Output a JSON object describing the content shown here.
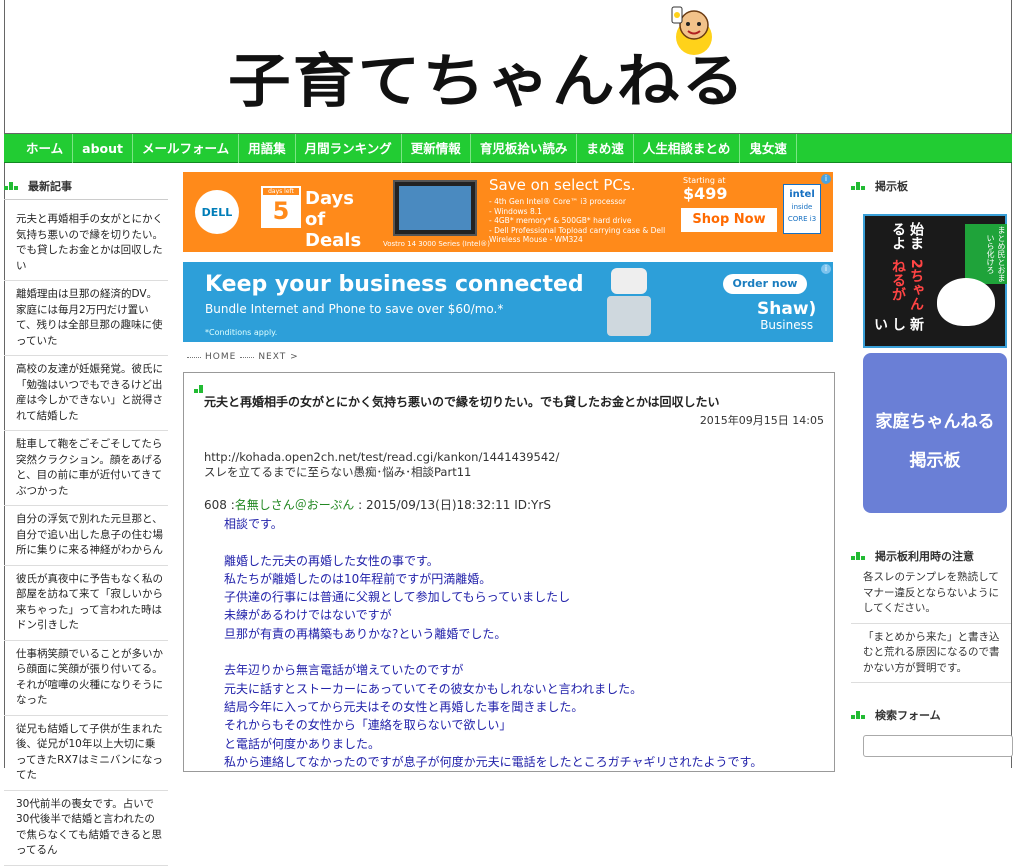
{
  "site": {
    "title": "子育てちゃんねる"
  },
  "nav": [
    {
      "label": "ホーム"
    },
    {
      "label": "about"
    },
    {
      "label": "メールフォーム"
    },
    {
      "label": "用語集"
    },
    {
      "label": "月間ランキング"
    },
    {
      "label": "更新情報"
    },
    {
      "label": "育児板拾い読み"
    },
    {
      "label": "まめ速"
    },
    {
      "label": "人生相談まとめ"
    },
    {
      "label": "鬼女速"
    }
  ],
  "sidebar_left": {
    "heading": "最新記事",
    "articles": [
      "元夫と再婚相手の女がとにかく気持ち悪いので縁を切りたい。でも貸したお金とかは回収したい",
      "離婚理由は旦那の経済的DV。家庭には毎月2万円だけ置いて、残りは全部旦那の趣味に使っていた",
      "高校の友達が妊娠発覚。彼氏に「勉強はいつでもできるけど出産は今しかできない」と説得されて結婚した",
      "駐車して鞄をごそごそしてたら突然クラクション。顔をあげると、目の前に車が近付いてきてぶつかった",
      "自分の浮気で別れた元旦那と、自分で追い出した息子の住む場所に集りに来る神経がわからん",
      "彼氏が真夜中に予告もなく私の部屋を訪ねて来て「寂しいから来ちゃった」って言われた時はドン引きした",
      "仕事柄笑顔でいることが多いから顔面に笑顔が張り付いてる。それが喧嘩の火種になりそうになった",
      "従兄も結婚して子供が生まれた後、従兄が10年以上大切に乗ってきたRX7はミニバンになってた",
      "30代前半の喪女です。占いで30代後半で結婚と言われたので焦らなくても結婚できると思ってるん"
    ]
  },
  "ads": {
    "ad1": {
      "brand": "DELL",
      "days_tag": "days left",
      "days_num": "5",
      "days_title": "Days of Deals",
      "headline": "Save on select PCs.",
      "starting": "Starting at",
      "price": "$499",
      "specs": [
        "- 4th Gen Intel® Core™ i3 processor",
        "- Windows 8.1",
        "- 4GB* memory* & 500GB* hard drive",
        "- Dell Professional Topload carrying case & Dell Wireless Mouse - WM324"
      ],
      "model": "Vostro 14 3000 Series (Intel®)",
      "cta": "Shop Now",
      "intel_line1": "intel",
      "intel_line2": "inside",
      "intel_line3": "CORE i3"
    },
    "ad2": {
      "headline": "Keep your business connected",
      "sub": "Bundle Internet and Phone to save over $60/mo.*",
      "note": "*Conditions apply.",
      "cta": "Order now",
      "brand": "Shaw)",
      "brand_sub": "Business"
    }
  },
  "breadcrumb": {
    "home": "HOME",
    "next": "NEXT >"
  },
  "post": {
    "title": "元夫と再婚相手の女がとにかく気持ち悪いので縁を切りたい。でも貸したお金とかは回収したい",
    "date": "2015年09月15日 14:05",
    "source_url": "http://kohada.open2ch.net/test/read.cgi/kankon/1441439542/",
    "source_title": "スレを立てるまでに至らない愚痴･悩み･相談Part11",
    "res_number": "608",
    "res_name": "名無しさん＠おーぷん",
    "res_meta": ": 2015/09/13(日)18:32:11 ID:YrS",
    "body": "相談です。\n\n離婚した元夫の再婚した女性の事です。\n私たちが離婚したのは10年程前ですが円満離婚。\n子供達の行事には普通に父親として参加してもらっていましたし\n未練があるわけではないですが\n旦那が有責の再構築もありかな?という離婚でした。\n\n去年辺りから無言電話が増えていたのですが\n元夫に話すとストーカーにあっていてその彼女かもしれないと言われました。\n結局今年に入ってから元夫はその女性と再婚した事を聞きました。\nそれからもその女性から「連絡を取らないで欲しい」\nと電話が何度かありました。\n私から連絡してなかったのですが息子が何度か元夫に電話をしたところガチャギリされたようです。"
  },
  "sidebar_right": {
    "board_heading": "掲示板",
    "banner1_text": [
      "新しい",
      "2ちゃんねるが",
      "始まるよ"
    ],
    "banner1_ribbon": "まとめ民とおまいら化けろ",
    "banner2_line1": "家庭ちゃんねる",
    "banner2_line2": "掲示板",
    "notice_heading": "掲示板利用時の注意",
    "notices": [
      "各スレのテンプレを熟読してマナー違反とならないようにしてください。",
      "「まとめから来た」と書き込むと荒れる原因になるので書かない方が賢明です。"
    ],
    "search_heading": "検索フォーム",
    "search_placeholder": ""
  },
  "colors": {
    "nav_green": "#22cc33",
    "link_blue": "#2222aa",
    "name_green": "#228822",
    "dell_orange": "#ff8a1a",
    "shaw_blue": "#2d9fd9"
  }
}
